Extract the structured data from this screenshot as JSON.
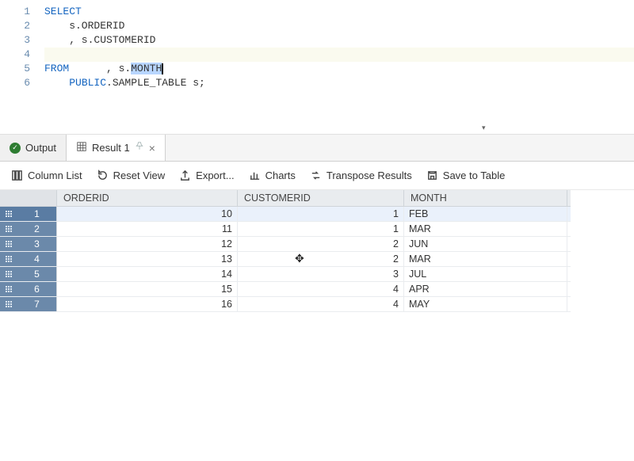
{
  "editor": {
    "lines": [
      {
        "n": 1,
        "html": "<span class='kw'>SELECT</span>"
      },
      {
        "n": 2,
        "html": "    s.ORDERID"
      },
      {
        "n": 3,
        "html": "    , s.CUSTOMERID"
      },
      {
        "n": 4,
        "html": "    , s.<span class='sel'>MONTH</span>"
      },
      {
        "n": 5,
        "html": "<span class='kw'>FROM</span>"
      },
      {
        "n": 6,
        "html": "    <span class='kw'>PUBLIC</span>.SAMPLE_TABLE s;"
      }
    ]
  },
  "tabs": {
    "output": "Output",
    "result1": "Result 1"
  },
  "toolbar": {
    "columnList": "Column List",
    "resetView": "Reset View",
    "export": "Export...",
    "charts": "Charts",
    "transpose": "Transpose Results",
    "saveTable": "Save to Table"
  },
  "grid": {
    "columns": [
      "ORDERID",
      "CUSTOMERID",
      "MONTH"
    ],
    "rows": [
      {
        "n": 1,
        "order": "10",
        "cust": "1",
        "month": "FEB"
      },
      {
        "n": 2,
        "order": "11",
        "cust": "1",
        "month": "MAR"
      },
      {
        "n": 3,
        "order": "12",
        "cust": "2",
        "month": "JUN"
      },
      {
        "n": 4,
        "order": "13",
        "cust": "2",
        "month": "MAR"
      },
      {
        "n": 5,
        "order": "14",
        "cust": "3",
        "month": "JUL"
      },
      {
        "n": 6,
        "order": "15",
        "cust": "4",
        "month": "APR"
      },
      {
        "n": 7,
        "order": "16",
        "cust": "4",
        "month": "MAY"
      }
    ]
  }
}
